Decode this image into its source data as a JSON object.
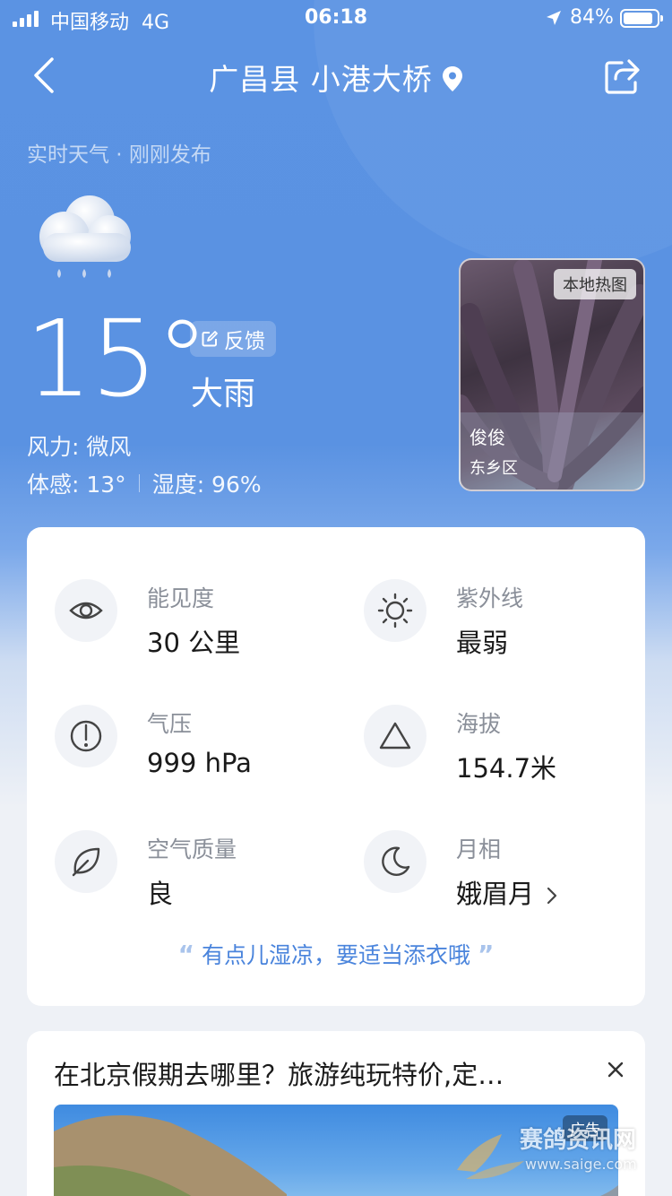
{
  "status_bar": {
    "carrier": "中国移动",
    "network": "4G",
    "time": "06:18",
    "battery": "84%"
  },
  "nav": {
    "title": "广昌县 小港大桥"
  },
  "weather": {
    "subtitle": "实时天气 · 刚刚发布",
    "temperature": "15°",
    "feedback_label": "反馈",
    "condition": "大雨",
    "wind": "风力: 微风",
    "feels_like": "体感: 13°",
    "humidity": "湿度: 96%",
    "icon": "cloud-rain-icon"
  },
  "photo_card": {
    "tag": "本地热图",
    "name": "俊俊",
    "area": "东乡区"
  },
  "details": {
    "visibility": {
      "label": "能见度",
      "value": "30 公里",
      "icon": "eye-icon"
    },
    "uv": {
      "label": "紫外线",
      "value": "最弱",
      "icon": "sun-icon"
    },
    "pressure": {
      "label": "气压",
      "value": "999 hPa",
      "icon": "gauge-icon"
    },
    "altitude": {
      "label": "海拔",
      "value": "154.7米",
      "icon": "mountain-icon"
    },
    "air_quality": {
      "label": "空气质量",
      "value": "良",
      "icon": "leaf-icon"
    },
    "moon": {
      "label": "月相",
      "value": "娥眉月",
      "icon": "moon-icon"
    },
    "tip": "有点儿湿凉，要适当添衣哦"
  },
  "ad": {
    "title": "在北京假期去哪里？旅游纯玩特价,定…",
    "badge": "广告"
  },
  "watermark": {
    "text": "赛鸽资讯网",
    "url": "www.saige.com"
  },
  "colors": {
    "hero_blue": "#5b93e3",
    "tip_blue": "#4a84dc"
  }
}
